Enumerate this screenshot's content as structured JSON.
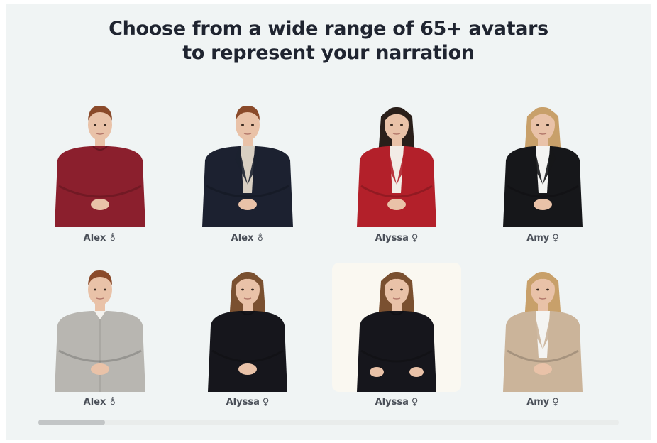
{
  "heading": {
    "line1": "Choose from a wide range of 65+ avatars",
    "line2": "to represent your narration"
  },
  "avatars": [
    {
      "name": "Alex",
      "symbol": "⚨",
      "gender_icon": "male-symbol-icon",
      "hair": "#8a4a2a",
      "top": "#8b1f2d",
      "inner": "#8b1f2d",
      "style": "sweater",
      "selected": false
    },
    {
      "name": "Alex",
      "symbol": "⚨",
      "gender_icon": "male-symbol-icon",
      "hair": "#8a4a2a",
      "top": "#1c2130",
      "inner": "#d8cfc2",
      "style": "blazer",
      "selected": false
    },
    {
      "name": "Alyssa",
      "symbol": "♀",
      "gender_icon": "female-symbol-icon",
      "hair": "#2a1f1a",
      "top": "#b3202a",
      "inner": "#f2ece6",
      "style": "blazer-f",
      "selected": false
    },
    {
      "name": "Amy",
      "symbol": "♀",
      "gender_icon": "female-symbol-icon",
      "hair": "#c8a06a",
      "top": "#16171a",
      "inner": "#f4f4f2",
      "style": "blazer-f",
      "selected": false
    },
    {
      "name": "Alex",
      "symbol": "⚨",
      "gender_icon": "male-symbol-icon",
      "hair": "#8a4a2a",
      "top": "#b8b6b1",
      "inner": "#b8b6b1",
      "style": "shirt",
      "selected": false
    },
    {
      "name": "Alyssa",
      "symbol": "♀",
      "gender_icon": "female-symbol-icon",
      "hair": "#7a5030",
      "top": "#16161c",
      "inner": "#16161c",
      "style": "top",
      "selected": false
    },
    {
      "name": "Alyssa",
      "symbol": "♀",
      "gender_icon": "female-symbol-icon",
      "hair": "#7a5030",
      "top": "#16161c",
      "inner": "#16161c",
      "style": "tee",
      "selected": true
    },
    {
      "name": "Amy",
      "symbol": "♀",
      "gender_icon": "female-symbol-icon",
      "hair": "#c8a06a",
      "top": "#cbb49a",
      "inner": "#f4f4f2",
      "style": "blazer-f",
      "selected": false
    }
  ],
  "colors": {
    "skin": "#e9c2a8",
    "panel_bg": "#f0f4f4",
    "selected_bg": "#faf8f1",
    "heading": "#1f2430"
  }
}
